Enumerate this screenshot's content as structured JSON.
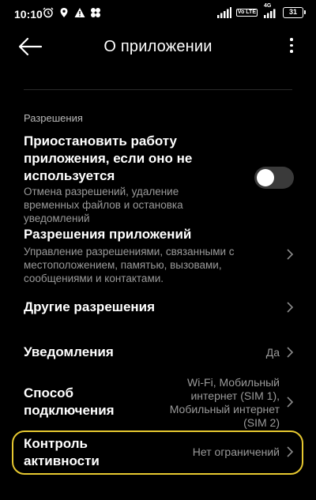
{
  "status_bar": {
    "time": "10:10",
    "network_label": "4G",
    "volte_label": "Vo LTE",
    "battery_level": "31"
  },
  "app_bar": {
    "title": "О приложении"
  },
  "permissions": {
    "section_header": "Разрешения",
    "pause_app": {
      "title": "Приостановить работу приложения, если оно не используется",
      "description": "Отмена разрешений, удаление временных файлов и остановка уведомлений",
      "enabled": false
    },
    "app_permissions": {
      "title": "Разрешения приложений",
      "description": "Управление разрешениями, связанными с местоположением, памятью, вызовами, сообщениями и контактами."
    },
    "other_permissions": {
      "title": "Другие разрешения"
    },
    "notifications": {
      "title": "Уведомления",
      "value": "Да"
    },
    "connection": {
      "title": "Способ подключения",
      "value": "Wi-Fi, Мобильный интернет (SIM 1), Мобильный интернет (SIM 2)"
    },
    "activity_control": {
      "title": "Контроль активности",
      "value": "Нет ограничений"
    }
  },
  "colors": {
    "background": "#000000",
    "highlight": "#e6c830",
    "secondary_text": "#9a9a9a"
  }
}
